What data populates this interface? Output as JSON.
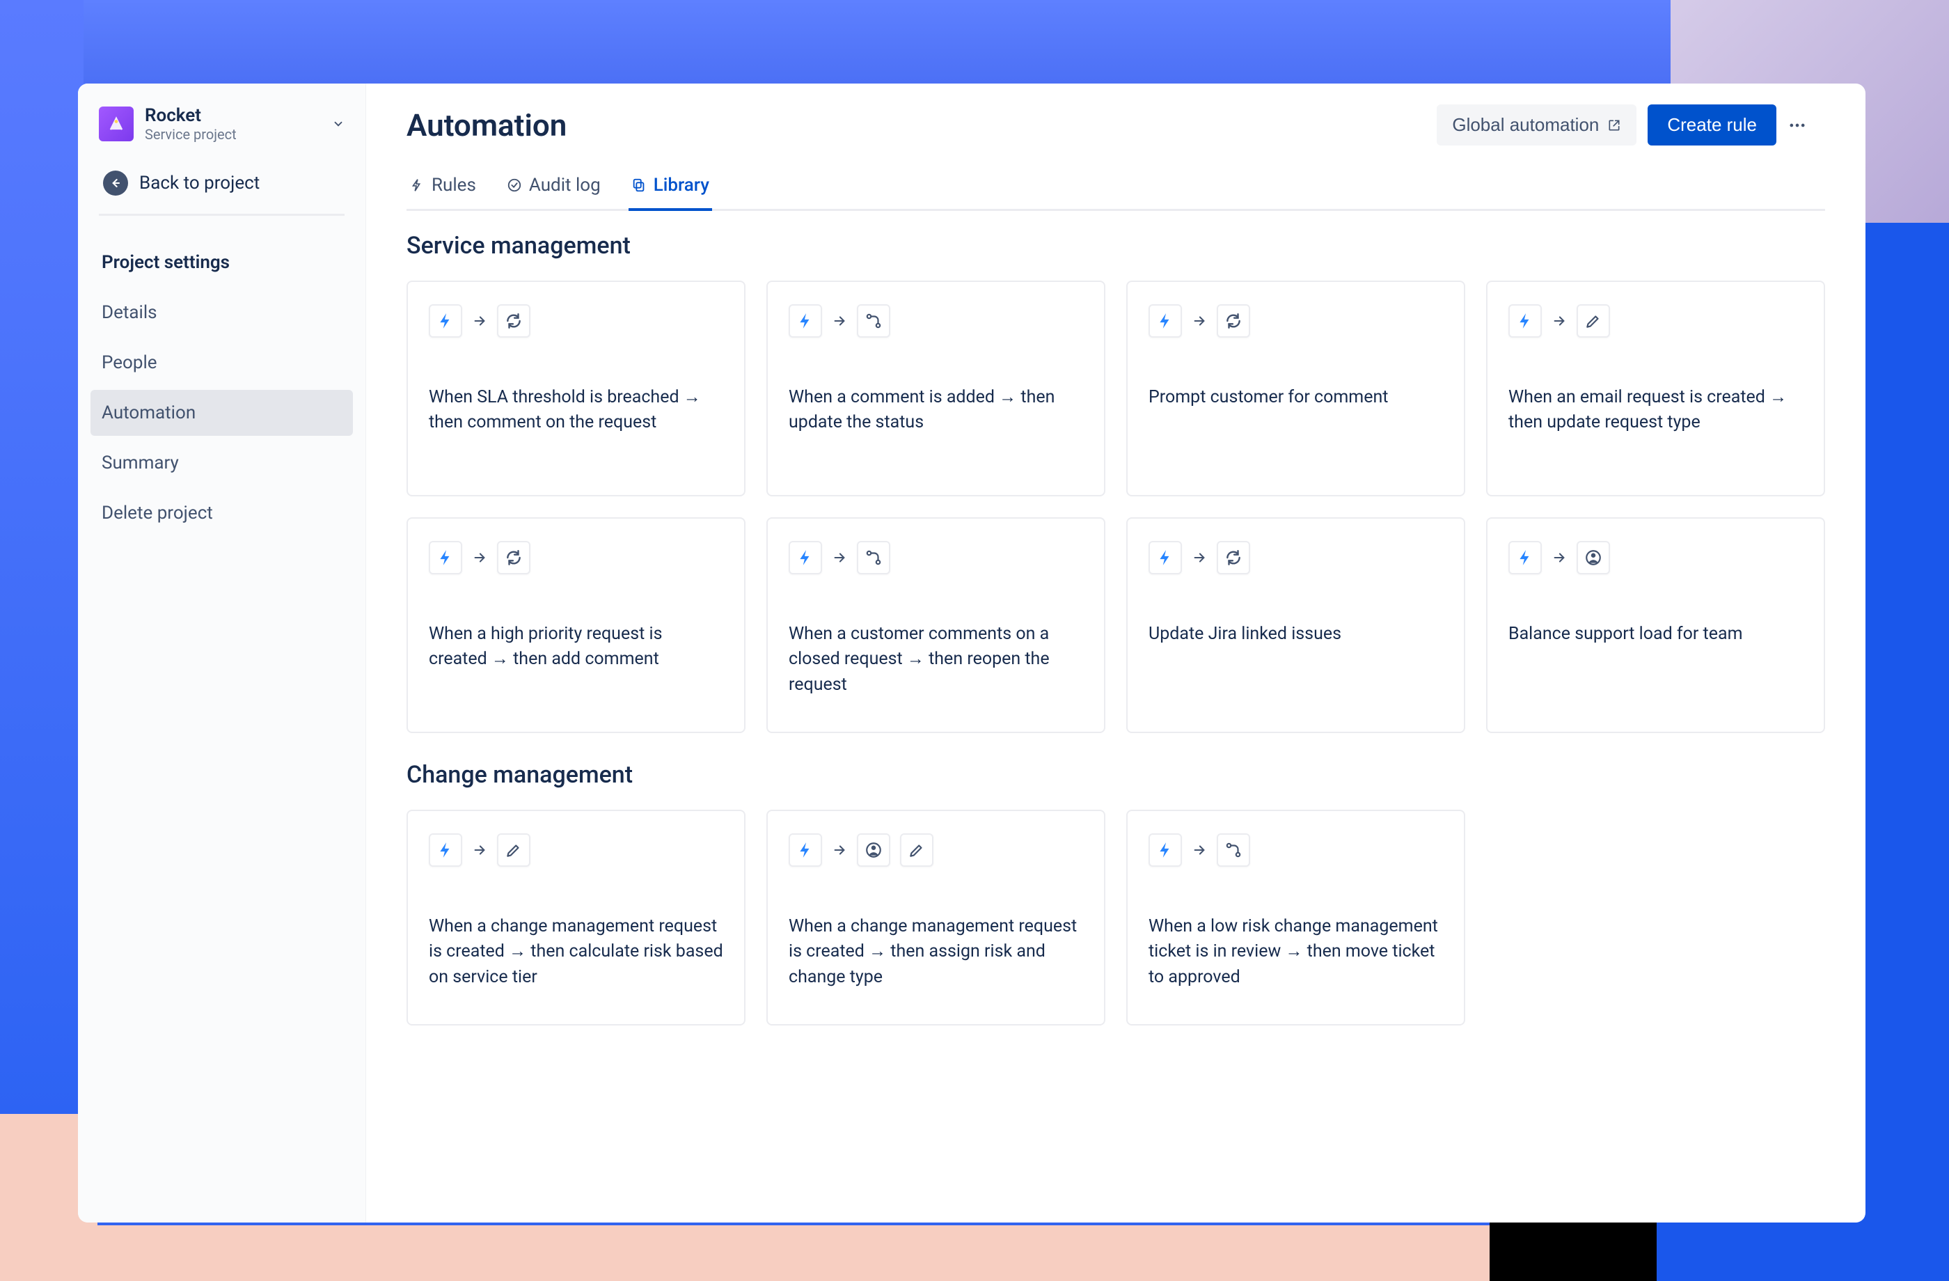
{
  "project": {
    "name": "Rocket",
    "subtitle": "Service project"
  },
  "sidebar": {
    "back_label": "Back to project",
    "nav": [
      {
        "label": "Project settings",
        "heading": true
      },
      {
        "label": "Details"
      },
      {
        "label": "People"
      },
      {
        "label": "Automation",
        "active": true
      },
      {
        "label": "Summary"
      },
      {
        "label": "Delete project"
      }
    ]
  },
  "header": {
    "title": "Automation",
    "global_label": "Global automation",
    "create_label": "Create rule"
  },
  "tabs": [
    {
      "label": "Rules",
      "icon": "bolt"
    },
    {
      "label": "Audit log",
      "icon": "check"
    },
    {
      "label": "Library",
      "icon": "copy",
      "active": true
    }
  ],
  "sections": [
    {
      "title": "Service management",
      "cards": [
        {
          "icons": [
            "bolt",
            "refresh"
          ],
          "desc": "When SLA threshold is breached → then comment on the request"
        },
        {
          "icons": [
            "bolt",
            "branch"
          ],
          "desc": "When a comment is added → then update the status"
        },
        {
          "icons": [
            "bolt",
            "refresh"
          ],
          "desc": "Prompt customer for comment"
        },
        {
          "icons": [
            "bolt",
            "edit"
          ],
          "desc": "When an email request is created → then update request type"
        },
        {
          "icons": [
            "bolt",
            "refresh"
          ],
          "desc": "When a high priority request is created → then add comment"
        },
        {
          "icons": [
            "bolt",
            "branch"
          ],
          "desc": "When a customer comments on a closed request → then reopen the request"
        },
        {
          "icons": [
            "bolt",
            "refresh"
          ],
          "desc": "Update Jira linked issues"
        },
        {
          "icons": [
            "bolt",
            "person"
          ],
          "desc": "Balance support load for team"
        }
      ]
    },
    {
      "title": "Change management",
      "cards": [
        {
          "icons": [
            "bolt",
            "edit"
          ],
          "desc": "When a change management request is created → then calculate risk based on service tier"
        },
        {
          "icons": [
            "bolt",
            "person",
            "edit"
          ],
          "desc": "When a change management request is created → then assign risk and change type"
        },
        {
          "icons": [
            "bolt",
            "branch"
          ],
          "desc": "When a low risk change management ticket is in review → then move ticket to approved"
        }
      ]
    }
  ]
}
